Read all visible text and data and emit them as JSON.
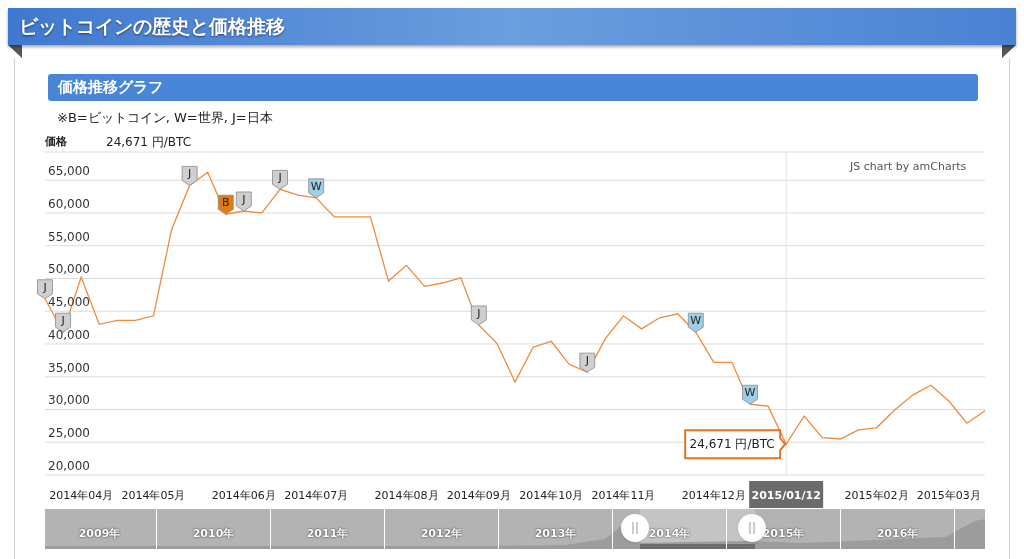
{
  "header": {
    "title": "ビットコインの歴史と価格推移"
  },
  "section": {
    "title": "価格推移グラフ",
    "note": "※B=ビットコイン, W=世界, J=日本"
  },
  "chart": {
    "legend": {
      "value": "24,671 円/BTC"
    },
    "point_marks": [
      {
        "kind": "flag",
        "letter": "J",
        "color": "#cfcfcf"
      },
      {
        "kind": "flag",
        "letter": "J",
        "color": "#cfcfcf"
      },
      {
        "kind": "point"
      },
      {
        "kind": "point"
      },
      {
        "kind": "point"
      },
      {
        "kind": "point"
      },
      {
        "kind": "point"
      },
      {
        "kind": "point"
      },
      {
        "kind": "flag",
        "letter": "J",
        "color": "#cfcfcf"
      },
      {
        "kind": "point"
      },
      {
        "kind": "flag",
        "letter": "B",
        "color": "#e07b14"
      },
      {
        "kind": "flag",
        "letter": "J",
        "color": "#cfcfcf"
      },
      {
        "kind": "point"
      },
      {
        "kind": "flag",
        "letter": "J",
        "color": "#cfcfcf"
      },
      {
        "kind": "point"
      },
      {
        "kind": "flag",
        "letter": "W",
        "color": "#9fcde6"
      },
      {
        "kind": "point"
      },
      {
        "kind": "point"
      },
      {
        "kind": "point"
      },
      {
        "kind": "point"
      },
      {
        "kind": "point"
      },
      {
        "kind": "point"
      },
      {
        "kind": "point"
      },
      {
        "kind": "point"
      },
      {
        "kind": "flag",
        "letter": "J",
        "color": "#cfcfcf"
      },
      {
        "kind": "point"
      },
      {
        "kind": "point"
      },
      {
        "kind": "point"
      },
      {
        "kind": "point"
      },
      {
        "kind": "point"
      },
      {
        "kind": "flag",
        "letter": "J",
        "color": "#cfcfcf"
      },
      {
        "kind": "point"
      },
      {
        "kind": "point"
      },
      {
        "kind": "point"
      },
      {
        "kind": "point"
      },
      {
        "kind": "point"
      },
      {
        "kind": "flag",
        "letter": "W",
        "color": "#9fcde6"
      },
      {
        "kind": "point"
      },
      {
        "kind": "point"
      },
      {
        "kind": "flag",
        "letter": "W",
        "color": "#9fcde6"
      },
      {
        "kind": "point"
      },
      {
        "kind": "tooltip",
        "text": "24,671 円/BTC"
      }
    ],
    "credit": "JS chart by amCharts",
    "cursor_label": "2015/01/12",
    "chart_data": {
      "type": "line",
      "grid": true,
      "categories": [
        null,
        null,
        "2014年04月",
        null,
        null,
        null,
        "2014年05月",
        null,
        null,
        null,
        null,
        "2014年06月",
        null,
        null,
        null,
        "2014年07月",
        null,
        null,
        null,
        null,
        "2014年08月",
        null,
        null,
        null,
        "2014年09月",
        null,
        null,
        null,
        "2014年10月",
        null,
        null,
        null,
        "2014年11月",
        null,
        null,
        null,
        null,
        "2014年12月",
        null,
        null,
        null,
        null,
        null,
        null,
        null,
        null,
        "2015年02月",
        null,
        null,
        null,
        "2015年03月",
        null,
        null
      ],
      "series": [
        {
          "name": "価格",
          "color": "#f08a3c",
          "values": [
            46900,
            41800,
            50200,
            43000,
            43600,
            43600,
            44300,
            57400,
            64200,
            66200,
            59800,
            60300,
            60000,
            63600,
            62700,
            62300,
            59400,
            59400,
            59400,
            49600,
            52000,
            48800,
            49300,
            50100,
            42900,
            40100,
            34200,
            39500,
            40400,
            36900,
            35700,
            40800,
            44300,
            42300,
            44000,
            44600,
            41800,
            37200,
            37200,
            30800,
            30500,
            24700,
            29000,
            25700,
            25500,
            26900,
            27200,
            29900,
            32200,
            33700,
            31300,
            27900,
            29800
          ]
        }
      ],
      "ylim": [
        20000,
        69300
      ],
      "yticks": [
        {
          "value": 20000,
          "label": "20,000"
        },
        {
          "value": 25000,
          "label": "25,000"
        },
        {
          "value": 30000,
          "label": "30,000"
        },
        {
          "value": 35000,
          "label": "35,000"
        },
        {
          "value": 40000,
          "label": "40,000"
        },
        {
          "value": 45000,
          "label": "45,000"
        },
        {
          "value": 50000,
          "label": "50,000"
        },
        {
          "value": 55000,
          "label": "55,000"
        },
        {
          "value": 60000,
          "label": "60,000"
        },
        {
          "value": 65000,
          "label": "65,000"
        }
      ]
    },
    "navigator": {
      "years": [
        "2009年",
        "2010年",
        "2011年",
        "2012年",
        "2013年",
        "2014年",
        "2015年",
        "2016年"
      ]
    }
  }
}
